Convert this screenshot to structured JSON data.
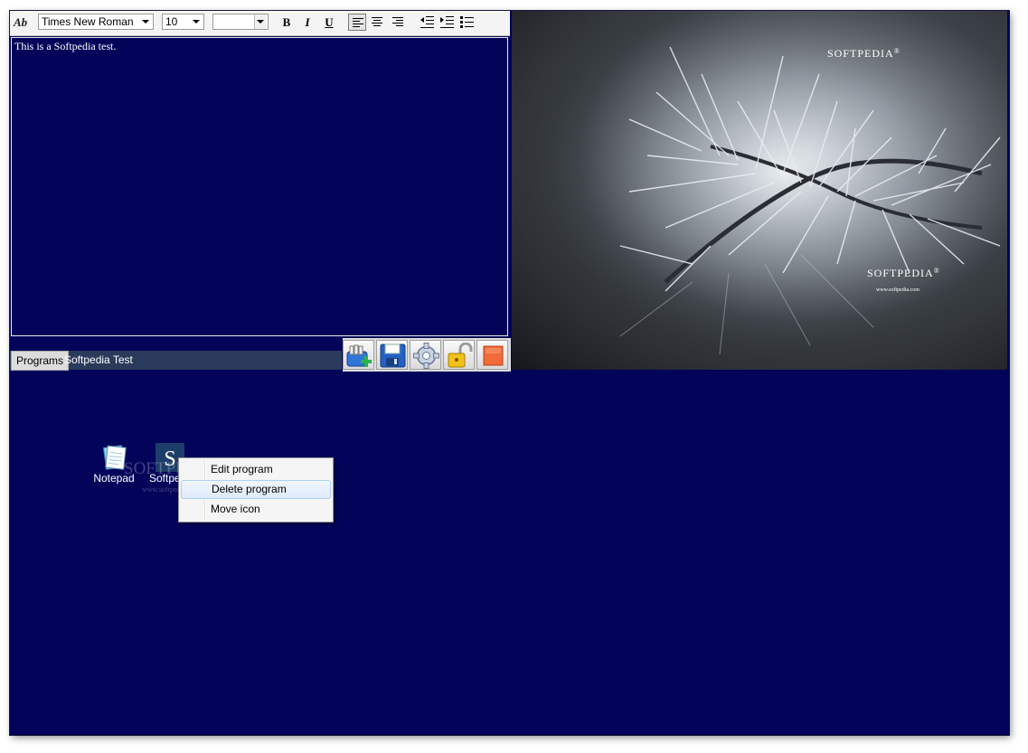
{
  "toolbar": {
    "font_icon": "Ab",
    "font_name": "Times New Roman",
    "font_size": "10",
    "color_value": "",
    "bold_label": "B",
    "italic_label": "I",
    "underline_label": "U"
  },
  "editor": {
    "text": "This is a Softpedia test."
  },
  "photo": {
    "logo_top": "SOFTPEDIA",
    "logo_bottom": "SOFTPEDIA",
    "logo_url": "www.softpedia.com",
    "trademark": "®"
  },
  "tabs": [
    {
      "label": "Programs",
      "active": true
    },
    {
      "label": "Softpedia Test",
      "active": false
    }
  ],
  "action_buttons": [
    "add-program-icon",
    "save-icon",
    "settings-gear-icon",
    "unlock-icon",
    "stop-icon"
  ],
  "desktop": {
    "icons": [
      {
        "label": "Notepad",
        "icon": "notepad-icon"
      },
      {
        "label": "Softpe",
        "icon": "softpedia-icon"
      }
    ],
    "watermark": "SOFTPEDIA",
    "watermark_url": "www.softpedia.com"
  },
  "context_menu": {
    "items": [
      {
        "label": "Edit program"
      },
      {
        "label": "Delete program",
        "highlighted": true
      },
      {
        "label": "Move icon"
      }
    ]
  },
  "colors": {
    "background": "#03035a",
    "menu_highlight": "#dfeafb",
    "tab_strip": "#2a3a5a"
  }
}
